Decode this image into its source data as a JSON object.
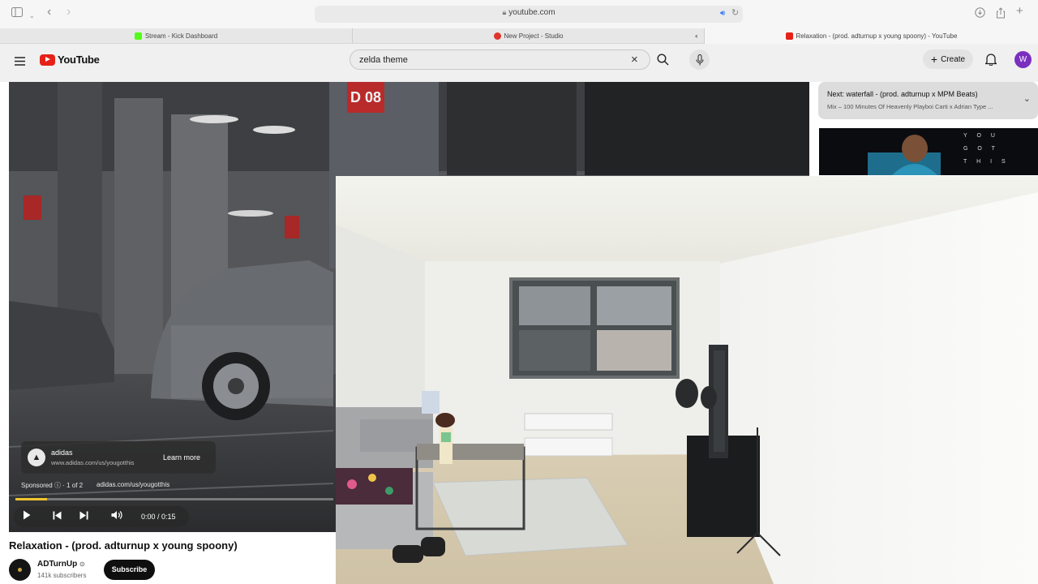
{
  "browser": {
    "url": "youtube.com",
    "tabs": [
      {
        "label": "Stream - Kick Dashboard",
        "favicon_color": "#53fc18"
      },
      {
        "label": "New Project - Studio",
        "favicon_color": "#e0352b"
      },
      {
        "label": "Relaxation - (prod. adturnup x young spoony) - YouTube",
        "favicon_color": "#e62117"
      }
    ]
  },
  "youtube": {
    "logo_text": "YouTube",
    "search": {
      "value": "zelda theme"
    },
    "create_label": "Create",
    "avatar_initial": "W"
  },
  "player": {
    "ad": {
      "brand": "adidas",
      "url": "www.adidas.com/us/yougotthis",
      "learn_more": "Learn more",
      "sponsored": "Sponsored",
      "count": "1 of 2",
      "link": "adidas.com/us/yougotthis",
      "progress": 0.1,
      "garage_sign": "D 08"
    },
    "time": "0:00 / 0:15"
  },
  "video": {
    "title": "Relaxation - (prod. adturnup x young spoony)",
    "channel": "ADTurnUp",
    "subscribers": "141k subscribers",
    "subscribe_label": "Subscribe"
  },
  "up_next": {
    "title": "Next: waterfall - (prod. adturnup x MPM Beats)",
    "subtitle": "Mix – 100 Minutes Of Heavenly Playboi Carti x Adrian Type ...",
    "thumb_text": "YOU GOT THIS"
  },
  "colors": {
    "youtube_red": "#e62117",
    "avatar_purple": "#7b2fbf",
    "ad_progress": "#f4c430"
  }
}
